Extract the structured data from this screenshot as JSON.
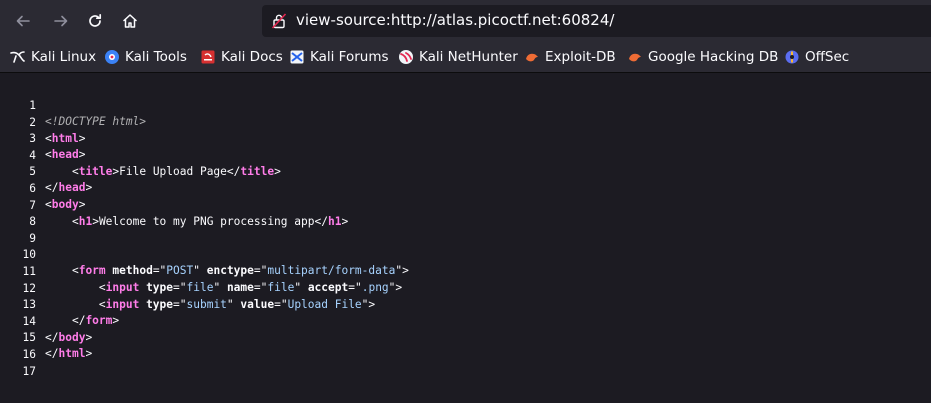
{
  "browser": {
    "url": "view-source:http://atlas.picoctf.net:60824/"
  },
  "bookmarks": [
    {
      "label": "Kali Linux",
      "icon": "kali-dragon-icon"
    },
    {
      "label": "Kali Tools",
      "icon": "kali-tools-icon"
    },
    {
      "label": "Kali Docs",
      "icon": "kali-docs-icon"
    },
    {
      "label": "Kali Forums",
      "icon": "kali-forums-icon"
    },
    {
      "label": "Kali NetHunter",
      "icon": "kali-nethunter-icon"
    },
    {
      "label": "Exploit-DB",
      "icon": "exploit-db-icon"
    },
    {
      "label": "Google Hacking DB",
      "icon": "ghdb-icon"
    },
    {
      "label": "OffSec",
      "icon": "offsec-icon"
    }
  ],
  "source": {
    "line_numbers": [
      "1",
      "2",
      "3",
      "4",
      "5",
      "6",
      "7",
      "8",
      "9",
      "10",
      "11",
      "12",
      "13",
      "14",
      "15",
      "16",
      "17"
    ],
    "lines": [
      {
        "doctype": "<!DOCTYPE html>"
      },
      {
        "t1": "<",
        "tag": "html",
        "t2": ">"
      },
      {
        "t1": "<",
        "tag": "head",
        "t2": ">"
      },
      {
        "indent": "    ",
        "t1": "<",
        "tag": "title",
        "t2": ">",
        "text": "File Upload Page",
        "t3": "</",
        "tag2": "title",
        "t4": ">"
      },
      {
        "t1": "</",
        "tag": "head",
        "t2": ">"
      },
      {
        "t1": "<",
        "tag": "body",
        "t2": ">"
      },
      {
        "indent": "    ",
        "t1": "<",
        "tag": "h1",
        "t2": ">",
        "text": "Welcome to my PNG processing app",
        "t3": "</",
        "tag2": "h1",
        "t4": ">"
      },
      {},
      {},
      {
        "indent": "    ",
        "t1": "<",
        "tag": "form",
        "a1": " method",
        "e1": "=\"",
        "v1": "POST",
        "q1": "\"",
        "a2": " enctype",
        "e2": "=\"",
        "v2": "multipart/form-data",
        "q2": "\"",
        "t2": ">"
      },
      {
        "indent": "        ",
        "t1": "<",
        "tag": "input",
        "a1": " type",
        "e1": "=\"",
        "v1": "file",
        "q1": "\"",
        "a2": " name",
        "e2": "=\"",
        "v2": "file",
        "q2": "\"",
        "a3": " accept",
        "e3": "=\"",
        "v3": ".png",
        "q3": "\"",
        "t2": ">"
      },
      {
        "indent": "        ",
        "t1": "<",
        "tag": "input",
        "a1": " type",
        "e1": "=\"",
        "v1": "submit",
        "q1": "\"",
        "a2": " value",
        "e2": "=\"",
        "v2": "Upload File",
        "q2": "\"",
        "t2": ">"
      },
      {
        "indent": "    ",
        "t1": "</",
        "tag": "form",
        "t2": ">"
      },
      {
        "t1": "</",
        "tag": "body",
        "t2": ">"
      },
      {
        "t1": "</",
        "tag": "html",
        "t2": ">"
      },
      {},
      {}
    ]
  },
  "colors": {
    "tag": "#ff7de9",
    "attr_value": "#a7d3ff",
    "toolbar_bg": "#2b2a33",
    "page_bg": "#1c1b22"
  }
}
